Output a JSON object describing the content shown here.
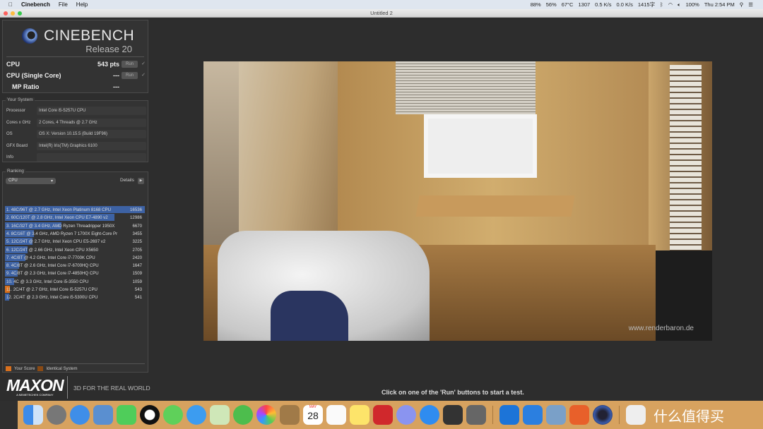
{
  "menubar": {
    "app": "Cinebench",
    "items": [
      "File",
      "Help"
    ],
    "status": {
      "mem": "88%",
      "ssd": "56%",
      "sen": "67°C",
      "rpm": "1307",
      "net_up": "0.5 K/s",
      "net_down": "0.0 K/s",
      "word_count": "1415字",
      "battery": "100%",
      "clock": "Thu 2:54 PM"
    }
  },
  "window": {
    "title": "Untitled 2"
  },
  "header": {
    "brand": "CINEBENCH",
    "release": "Release 20"
  },
  "scores": [
    {
      "label": "CPU",
      "value": "543 pts",
      "run": "Run"
    },
    {
      "label": "CPU (Single Core)",
      "value": "---",
      "run": "Run"
    },
    {
      "label": "MP Ratio",
      "value": "---"
    }
  ],
  "your_system": {
    "title": "Your System",
    "rows": [
      {
        "k": "Processor",
        "v": "Intel Core i5-5257U CPU"
      },
      {
        "k": "Cores x GHz",
        "v": "2 Cores, 4 Threads @ 2.7 GHz"
      },
      {
        "k": "OS",
        "v": "OS X: Version 10.15.5 (Build 19F96)"
      },
      {
        "k": "GFX Board",
        "v": "Intel(R) Iris(TM) Graphics 6100"
      },
      {
        "k": "Info",
        "v": ""
      }
    ]
  },
  "ranking": {
    "title": "Ranking",
    "select": "CPU",
    "details": "Details",
    "items": [
      {
        "name": "1. 48C/96T @ 2.7 GHz, Intel Xeon Platinum 8168 CPU",
        "score": 16536
      },
      {
        "name": "2. 60C/120T @ 2.8 GHz, Intel Xeon CPU E7-4890 v2",
        "score": 12986
      },
      {
        "name": "3. 16C/32T @ 3.4 GHz, AMD Ryzen Threadripper 1950X",
        "score": 6670
      },
      {
        "name": "4. 8C/16T @ 3.4 GHz, AMD Ryzen 7 1700X Eight-Core Pr",
        "score": 3455
      },
      {
        "name": "5. 12C/24T @ 2.7 GHz, Intel Xeon CPU E5-2697 v2",
        "score": 3225
      },
      {
        "name": "6. 12C/24T @ 2.66 GHz, Intel Xeon CPU X5650",
        "score": 2705
      },
      {
        "name": "7. 4C/8T @ 4.2 GHz, Intel Core i7-7700K CPU",
        "score": 2420
      },
      {
        "name": "8. 4C/8T @ 2.6 GHz, Intel Core i7-6700HQ CPU",
        "score": 1647
      },
      {
        "name": "9. 4C/8T @ 2.3 GHz, Intel Core i7-4850HQ CPU",
        "score": 1509
      },
      {
        "name": "10. 4C @ 3.3 GHz, Intel Core i5-3550 CPU",
        "score": 1059
      },
      {
        "name": "11. 2C/4T @ 2.7 GHz, Intel Core i5-5257U CPU",
        "score": 543,
        "yours": true
      },
      {
        "name": "12. 2C/4T @ 2.3 GHz, Intel Core i5-5300U CPU",
        "score": 541
      }
    ],
    "legend": [
      "Your Score",
      "Identical System"
    ]
  },
  "footer": {
    "brand": "MAXON",
    "sub": "A NEMETSCHEK COMPANY",
    "tagline": "3D FOR THE REAL WORLD"
  },
  "render": {
    "watermark": "www.renderbaron.de"
  },
  "status_text": "Click on one of the 'Run' buttons to start a test.",
  "dock": {
    "calendar_day": "28",
    "calendar_month": "MAY",
    "watermark": "什么值得买"
  },
  "colors": {
    "bar": "#3d62a4",
    "your_score": "#d8701e",
    "identical": "#8a4a14"
  }
}
